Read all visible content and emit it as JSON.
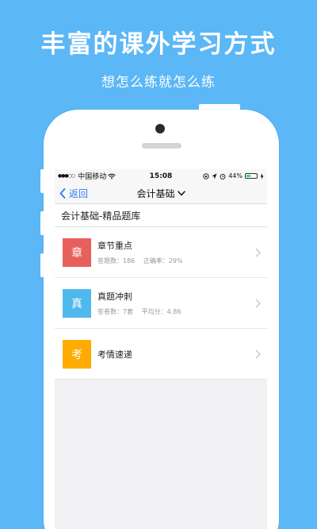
{
  "promo": {
    "headline": "丰富的课外学习方式",
    "subline": "想怎么练就怎么练"
  },
  "status_bar": {
    "carrier": "中国移动",
    "time": "15:08",
    "battery": "44%",
    "battery_level": 0.44
  },
  "nav": {
    "back_label": "返回",
    "title": "会计基础"
  },
  "section_title": "会计基础-精品题库",
  "items": [
    {
      "tile": "章",
      "title": "章节重点",
      "stat1": "答题数：186",
      "stat2": "正确率：29%",
      "color": "#e8605c"
    },
    {
      "tile": "真",
      "title": "真题冲刺",
      "stat1": "答卷数：7套",
      "stat2": "平均分：4.86",
      "color": "#4fb9ee"
    },
    {
      "tile": "考",
      "title": "考情速递",
      "stat1": "",
      "stat2": "",
      "color": "#ffab00"
    }
  ],
  "colors": {
    "background": "#5bb7f5",
    "accent": "#2f7cf6"
  }
}
